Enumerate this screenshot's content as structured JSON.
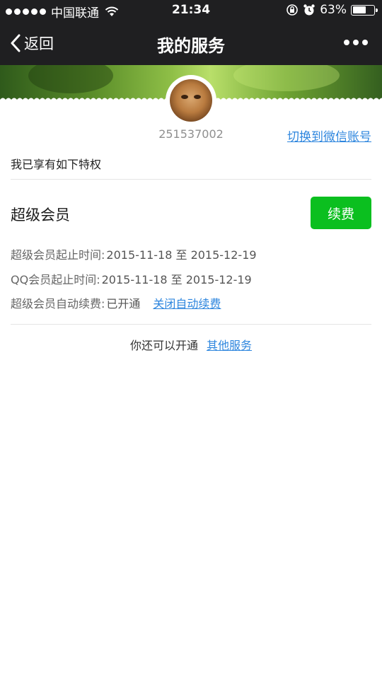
{
  "status_bar": {
    "carrier": "中国联通",
    "time": "21:34",
    "battery_percent": "63%",
    "battery_level": 0.63
  },
  "nav": {
    "back_label": "返回",
    "title": "我的服务"
  },
  "profile": {
    "account_id": "251537002",
    "switch_link": "切换到微信账号"
  },
  "privilege_heading": "我已享有如下特权",
  "vip": {
    "title": "超级会员",
    "renew_button": "续费",
    "rows": [
      {
        "label": "超级会员起止时间:",
        "value": "2015-11-18 至 2015-12-19"
      },
      {
        "label": "QQ会员起止时间:",
        "value": "2015-11-18 至 2015-12-19"
      },
      {
        "label": "超级会员自动续费:",
        "value": "已开通",
        "link": "关闭自动续费"
      }
    ]
  },
  "more_services": {
    "text": "你还可以开通",
    "link": "其他服务"
  },
  "colors": {
    "accent_green": "#0bbf1f",
    "link_blue": "#2e86de",
    "nav_bg": "#1f1f21"
  },
  "icons": [
    "signal-dots-icon",
    "wifi-icon",
    "rotation-lock-icon",
    "alarm-icon",
    "battery-icon",
    "back-chevron-icon",
    "more-icon"
  ]
}
